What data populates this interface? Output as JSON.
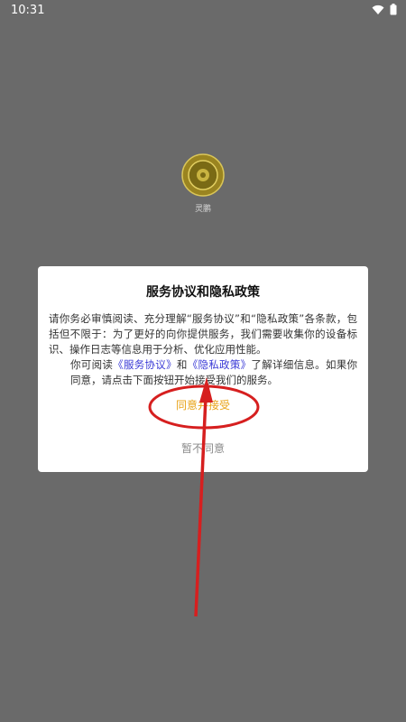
{
  "status_bar": {
    "time": "10:31"
  },
  "app": {
    "name": "灵鹏"
  },
  "dialog": {
    "title": "服务协议和隐私政策",
    "paragraph1": "请你务必审慎阅读、充分理解“服务协议”和“隐私政策”各条款，包括但不限于：为了更好的向你提供服务，我们需要收集你的设备标识、操作日志等信息用于分析、优化应用性能。",
    "p2_prefix": "你可阅读",
    "link_service": "《服务协议》",
    "p2_and": "和",
    "link_privacy": "《隐私政策》",
    "p2_suffix": "了解详细信息。如果你同意，请点击下面按钮开始接受我们的服务。",
    "agree_label": "同意并接受",
    "disagree_label": "暂不同意"
  },
  "colors": {
    "overlay": "#6a6a6a",
    "agree": "#e8a317",
    "disagree": "#8a8a8a",
    "link": "#3a3ad6",
    "annotation": "#d61f1f"
  }
}
